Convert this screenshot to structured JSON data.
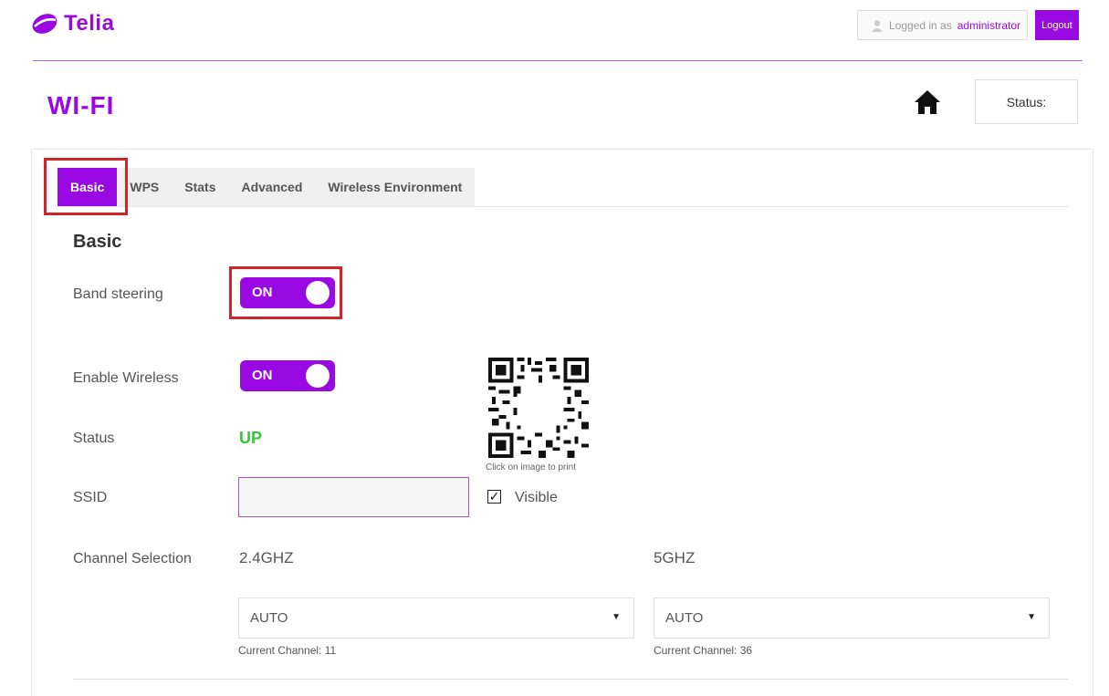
{
  "header": {
    "brand": "Telia",
    "logged_in_prefix": "Logged in as",
    "username": "administrator",
    "logout_label": "Logout"
  },
  "page": {
    "title": "WI-FI",
    "status_label": "Status:"
  },
  "tabs": [
    {
      "label": "Basic",
      "active": true
    },
    {
      "label": "WPS",
      "active": false
    },
    {
      "label": "Stats",
      "active": false
    },
    {
      "label": "Advanced",
      "active": false
    },
    {
      "label": "Wireless Environment",
      "active": false
    }
  ],
  "basic": {
    "section_title": "Basic",
    "band_steering": {
      "label": "Band steering",
      "value": "ON"
    },
    "enable_wireless": {
      "label": "Enable Wireless",
      "value": "ON"
    },
    "status": {
      "label": "Status",
      "value": "UP"
    },
    "ssid": {
      "label": "SSID",
      "value": "",
      "visible_label": "Visible",
      "visible_checked": true
    },
    "qr_caption": "Click on image to print",
    "channel_selection": {
      "label": "Channel Selection",
      "bands": [
        {
          "name": "2.4GHZ",
          "selected": "AUTO",
          "current": "Current Channel: 11"
        },
        {
          "name": "5GHZ",
          "selected": "AUTO",
          "current": "Current Channel: 36"
        }
      ]
    }
  },
  "colors": {
    "accent": "#990ae3",
    "status_up": "#36c536",
    "highlight": "#d0242b"
  }
}
